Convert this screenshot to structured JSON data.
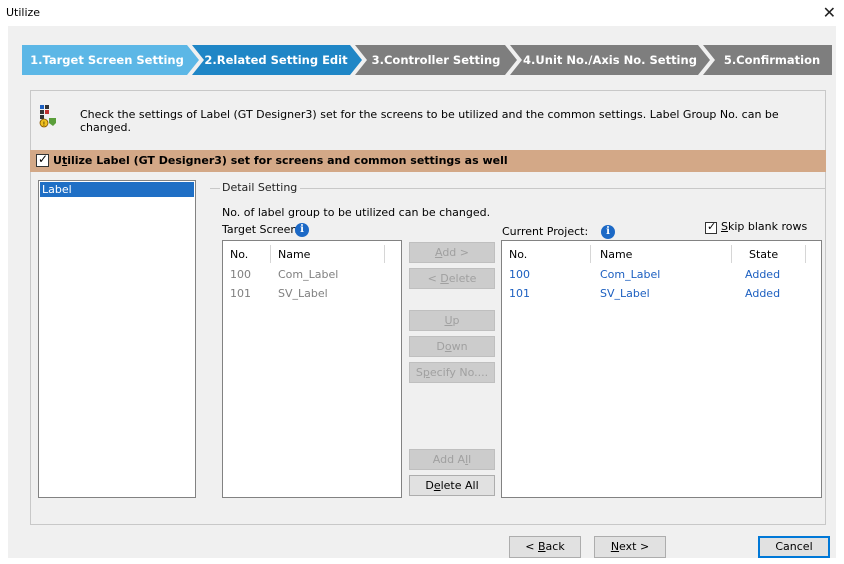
{
  "window": {
    "title": "Utilize",
    "close_glyph": "✕"
  },
  "steps": [
    {
      "label": "1.Target Screen Setting",
      "state": "active",
      "color": "#5cb7e6"
    },
    {
      "label": "2.Related Setting Edit",
      "state": "current",
      "color": "#1f86c6"
    },
    {
      "label": "3.Controller Setting",
      "state": "pending",
      "color": "#7e7e7e"
    },
    {
      "label": "4.Unit No./Axis No. Setting",
      "state": "pending",
      "color": "#7e7e7e"
    },
    {
      "label": "5.Confirmation",
      "state": "pending",
      "color": "#7e7e7e"
    }
  ],
  "info": {
    "text": "Check the settings of Label (GT Designer3) set for the screens to be utilized and the common settings. Label Group No. can be changed."
  },
  "utilize_checkbox": {
    "checked": true,
    "label_prefix": "U",
    "label_accel": "t",
    "label_rest": "ilize Label (GT Designer3) set for screens and common settings as well",
    "band_color": "#d3a887"
  },
  "tree": {
    "items": [
      "Label"
    ],
    "selected": "Label"
  },
  "detail": {
    "group_label": "Detail Setting",
    "description": "No. of label group to be utilized can be changed.",
    "target_header": "Target Screen:",
    "current_header": "Current Project:",
    "skip_blank": {
      "checked": true,
      "accel": "S",
      "rest": "kip blank rows"
    }
  },
  "target_list": {
    "columns": [
      "No.",
      "Name"
    ],
    "rows": [
      {
        "no": "100",
        "name": "Com_Label"
      },
      {
        "no": "101",
        "name": "SV_Label"
      }
    ]
  },
  "current_list": {
    "columns": [
      "No.",
      "Name",
      "State"
    ],
    "rows": [
      {
        "no": "100",
        "name": "Com_Label",
        "state": "Added"
      },
      {
        "no": "101",
        "name": "SV_Label",
        "state": "Added"
      }
    ]
  },
  "middle_buttons": {
    "add": {
      "accel": "A",
      "rest": "dd >",
      "enabled": false
    },
    "delete": {
      "prefix": "< ",
      "accel": "D",
      "rest": "elete",
      "enabled": false
    },
    "up": {
      "accel": "U",
      "rest": "p",
      "enabled": false
    },
    "down": {
      "prefix": "D",
      "accel": "o",
      "rest": "wn",
      "enabled": false
    },
    "specify": {
      "prefix": "S",
      "accel": "p",
      "rest": "ecify No....",
      "enabled": false
    },
    "add_all": {
      "prefix": "Add A",
      "accel": "l",
      "rest": "l",
      "enabled": false
    },
    "delete_all": {
      "prefix": "D",
      "accel": "e",
      "rest": "lete All",
      "enabled": true
    }
  },
  "footer": {
    "back": {
      "prefix": "< ",
      "accel": "B",
      "rest": "ack"
    },
    "next": {
      "accel": "N",
      "rest": "ext >"
    },
    "cancel": {
      "label": "Cancel"
    }
  }
}
